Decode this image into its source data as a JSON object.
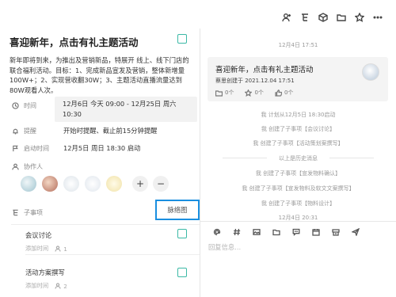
{
  "header": {
    "icons": [
      "user-add-icon",
      "hierarchy-icon",
      "cube-icon",
      "folder-icon",
      "star-icon",
      "more-icon"
    ]
  },
  "task": {
    "title": "喜迎新年，点击有礼主题活动",
    "description": "新年即将到来，为推出及营销新品，特展开 线上、线下门店的联合福利活动。目标：1、完成新品宣发及营销，整体新增量100W+；2、实现营收翻30W；3、主题活动直播流量达到80W观看人次。",
    "fields": {
      "time_label": "时间",
      "time_value": "12月6日 今天 09:00 - 12月25日 周六 10:30",
      "reminder_label": "提醒",
      "reminder_value": "开始时提醒、截止前15分钟提醒",
      "start_label": "启动时间",
      "start_value": "12月5日 周日 18:30 启动",
      "collaborators_label": "协作人",
      "add_symbol": "+",
      "remove_symbol": "−"
    },
    "subtasks_label": "子事项",
    "mindmap_label": "脉络图",
    "subtasks": [
      {
        "title": "会议讨论",
        "meta": "添加时间",
        "count": "1"
      },
      {
        "title": "活动方案撰写",
        "meta": "添加时间",
        "count": "2"
      }
    ]
  },
  "activity": {
    "top_timestamp": "12月4日 17:51",
    "card": {
      "title": "喜迎新年，点击有礼主题活动",
      "creator": "蔡思创建于 2021.12.04 17:51",
      "files": "0个",
      "stars": "0个",
      "likes": "0个"
    },
    "entries": [
      "我 计划从12月5日 18:30启动",
      "我 创建了子事项【会议讨论】",
      "我 创建了子事项【活动策划案撰写】"
    ],
    "history_label": "以上是历史消息",
    "history_entries": [
      "我 创建了子事项【宣发物料确认】",
      "我 创建了子事项【宣发物料及软文文案撰写】",
      "我 创建了子事项【物料设计】"
    ],
    "bottom_timestamp": "12月4日 20:31",
    "reply_placeholder": "回复信息..."
  },
  "colors": {
    "accent_teal": "#3bb9a6",
    "highlight_blue": "#1a8fe0"
  }
}
